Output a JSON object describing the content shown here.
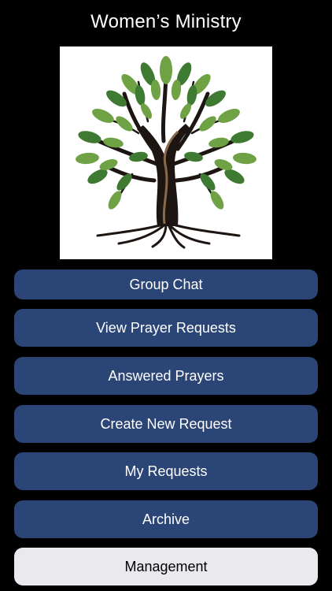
{
  "header": {
    "title": "Women’s Ministry"
  },
  "logo": {
    "icon": "tree-icon",
    "colors": {
      "background": "#ffffff",
      "leaf_light": "#6fa145",
      "leaf_dark": "#3f7a32",
      "trunk": "#1d1512",
      "trunk_highlight": "#8a6a4c"
    }
  },
  "menu": {
    "items": [
      {
        "label": "Group Chat"
      },
      {
        "label": "View Prayer Requests"
      },
      {
        "label": "Answered Prayers"
      },
      {
        "label": "Create New Request"
      },
      {
        "label": "My Requests"
      },
      {
        "label": "Archive"
      },
      {
        "label": "Management"
      }
    ]
  },
  "colors": {
    "background": "#000000",
    "button_primary": "#2b4577",
    "button_secondary": "#e9e9ee",
    "text_light": "#ffffff",
    "text_dark": "#000000"
  }
}
